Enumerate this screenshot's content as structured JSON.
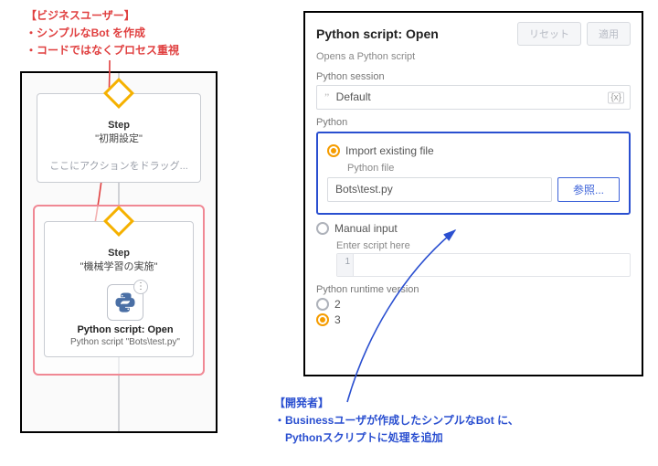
{
  "annotations": {
    "left": {
      "heading": "【ビジネスユーザー】",
      "line1": "・シンプルなBot を作成",
      "line2": "・コードではなくプロセス重視"
    },
    "right": {
      "heading": "【開発者】",
      "line1": "・Businessユーザが作成したシンプルなBot に、",
      "line2": "　Pythonスクリプトに処理を追加"
    }
  },
  "designer": {
    "step_label": "Step",
    "step1_name": "\"初期設定\"",
    "drop_hint": "ここにアクションをドラッグ...",
    "step2_name": "\"機械学習の実施\"",
    "action_title": "Python script: Open",
    "action_sub": "Python script \"Bots\\test.py\""
  },
  "panel": {
    "title": "Python script: Open",
    "reset": "リセット",
    "apply": "適用",
    "desc": "Opens a Python script",
    "session_label": "Python session",
    "session_value": "Default",
    "python_label": "Python",
    "import_label": "Import existing file",
    "file_label": "Python file",
    "file_value": "Bots\\test.py",
    "browse": "参照...",
    "manual_label": "Manual input",
    "script_hint": "Enter script here",
    "gutter_1": "1",
    "runtime_label": "Python runtime version",
    "rt2": "2",
    "rt3": "3"
  }
}
